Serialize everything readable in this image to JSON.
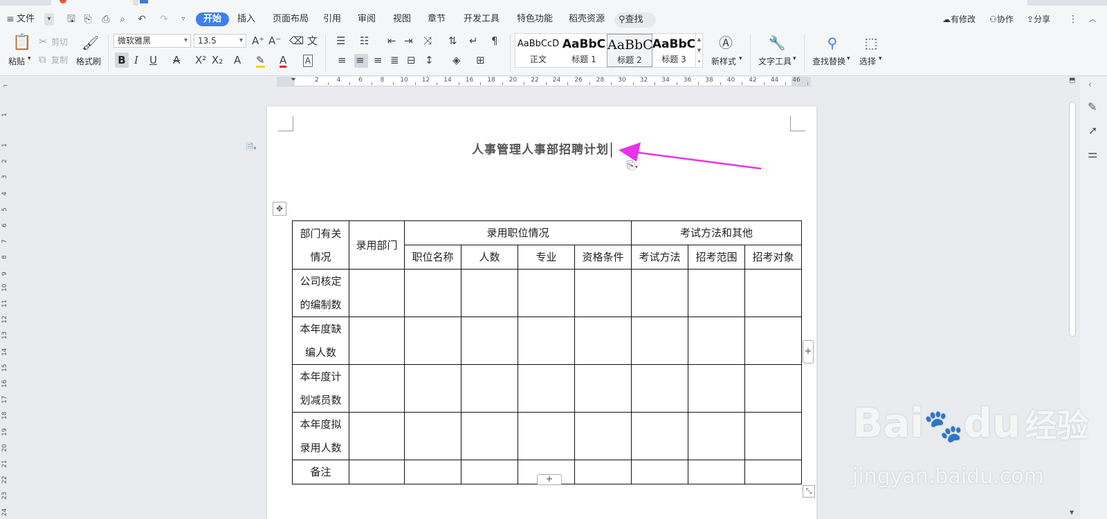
{
  "menu": {
    "file": "文件",
    "tabs": [
      "开始",
      "插入",
      "页面布局",
      "引用",
      "审阅",
      "视图",
      "章节",
      "开发工具",
      "特色功能",
      "稻壳资源"
    ],
    "search": "查找",
    "right": {
      "changes": "有修改",
      "collab": "协作",
      "share": "分享"
    }
  },
  "ribbon": {
    "paste": "粘贴",
    "cut": "剪切",
    "copy": "复制",
    "format_painter": "格式刷",
    "font_name": "微软雅黑",
    "font_size": "13.5",
    "styles": [
      {
        "preview": "AaBbCcD",
        "name": "正文"
      },
      {
        "preview": "AaBbC",
        "name": "标题 1"
      },
      {
        "preview": "AaBbC",
        "name": "标题 2"
      },
      {
        "preview": "AaBbC",
        "name": "标题 3"
      }
    ],
    "new_style": "新样式",
    "text_tools": "文字工具",
    "find_replace": "查找替换",
    "select": "选择"
  },
  "ruler": {
    "h": [
      "2",
      "4",
      "6",
      "8",
      "10",
      "12",
      "14",
      "16",
      "18",
      "20",
      "22",
      "24",
      "26",
      "28",
      "30",
      "32",
      "34",
      "36",
      "38",
      "40",
      "42",
      "44",
      "46"
    ],
    "v": [
      "1",
      "1",
      "2",
      "3",
      "4",
      "5",
      "6",
      "7",
      "8",
      "9",
      "10",
      "11",
      "12",
      "13",
      "14",
      "15",
      "16",
      "17",
      "18",
      "19",
      "20",
      "21",
      "22",
      "23",
      "24"
    ]
  },
  "document": {
    "title": "人事管理人事部招聘计划",
    "table": {
      "h_col1": "部门有关情况",
      "h_col2": "录用部门",
      "h_group1": "录用职位情况",
      "h_group2": "考试方法和其他",
      "sub": [
        "职位名称",
        "人数",
        "专业",
        "资格条件",
        "考试方法",
        "招考范围",
        "招考对象"
      ],
      "rows": [
        "公司核定的编制数",
        "本年度缺编人数",
        "本年度计划减员数",
        "本年度拟录用人数",
        "备注"
      ]
    }
  },
  "watermark": {
    "brand": "Bai",
    "brand2": "du",
    "cn": "经验",
    "url": "jingyan.baidu.com"
  },
  "colors": {
    "accent": "#3d7ff2",
    "arrow": "#e833e8"
  }
}
